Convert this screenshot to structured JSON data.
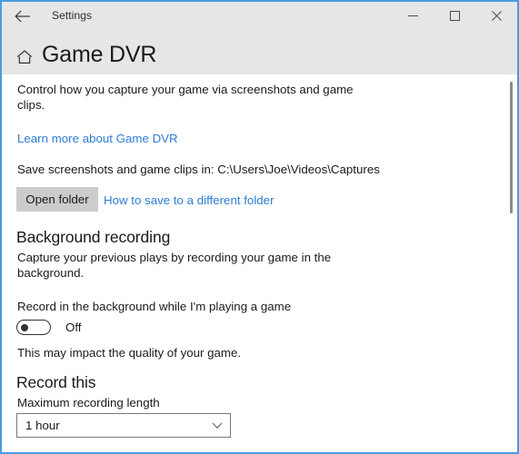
{
  "window": {
    "accent_border_color": "#4a9ce0",
    "header_bg_color": "#e6e6e6",
    "link_color": "#2d7dd2"
  },
  "titlebar": {
    "back_icon": "back-arrow-icon",
    "title": "Settings",
    "minimize_label": "Minimize",
    "maximize_label": "Maximize",
    "close_label": "Close"
  },
  "header": {
    "home_icon": "home-icon",
    "page_title": "Game DVR"
  },
  "content": {
    "intro_line1": "Control how you capture your game via screenshots and game",
    "intro_line2": "clips.",
    "learn_more_link": "Learn more about Game DVR",
    "save_path_text": "Save screenshots and game clips in: C:\\Users\\Joe\\Videos\\Captures",
    "open_folder_button": "Open folder",
    "how_to_save_link": "How to save to a different folder",
    "background_recording": {
      "heading": "Background recording",
      "desc_line1": "Capture your previous plays by recording your game in the",
      "desc_line2": "background.",
      "toggle_label": "Record in the background while I'm playing a game",
      "toggle_state": "Off",
      "impact_note": "This may impact the quality of your game."
    },
    "record_this": {
      "heading": "Record this",
      "max_length_label": "Maximum recording length",
      "max_length_value": "1 hour",
      "max_length_options": [
        "1 hour"
      ],
      "chevron_icon": "chevron-down-icon"
    }
  },
  "scrollbar": {
    "orientation": "vertical"
  }
}
